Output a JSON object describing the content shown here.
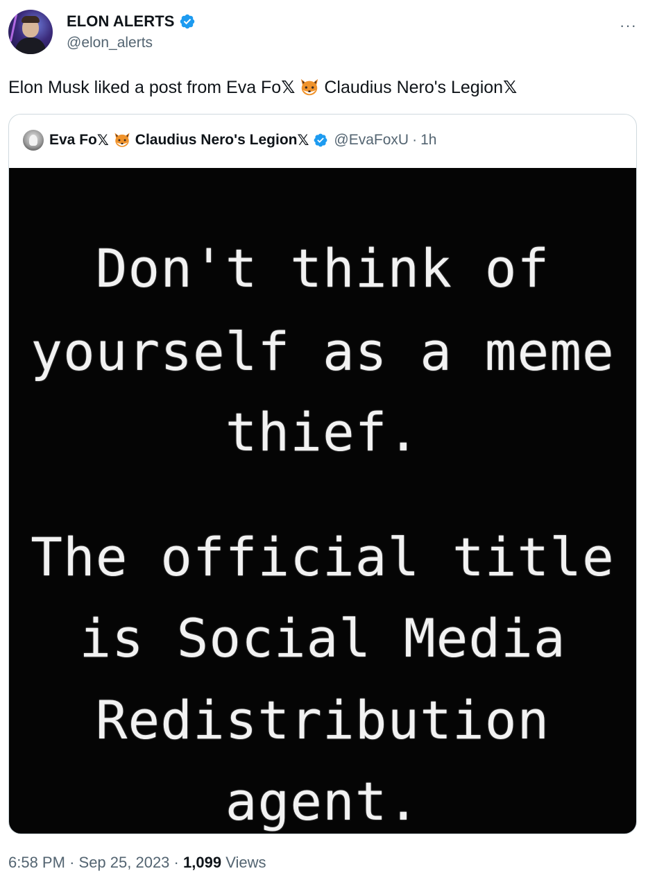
{
  "tweet": {
    "author": {
      "display_name": "ELON ALERTS",
      "handle": "@elon_alerts",
      "verified": true
    },
    "more_label": "···",
    "text_parts": [
      "Elon Musk liked a post from Eva Fo",
      "𝕏",
      "Claudius Nero's Legion ",
      "𝕏"
    ],
    "quote": {
      "display_name_a": "Eva Fo",
      "x_mark": "𝕏",
      "display_name_b": "Claudius Nero's Legion ",
      "x_mark_2": "𝕏",
      "handle": "@EvaFoxU",
      "separator": "·",
      "time": "1h",
      "image_lines": [
        "Don't think of",
        "yourself as a meme",
        "thief.",
        "The official title",
        "is Social Media",
        "Redistribution",
        "agent."
      ]
    },
    "footer": {
      "time": "6:58 PM",
      "sep1": "·",
      "date": "Sep 25, 2023",
      "sep2": "·",
      "views_count": "1,099",
      "views_label": "Views"
    },
    "colors": {
      "verified": "#1d9bf0",
      "secondary_text": "#536471",
      "border": "#cfd9de"
    },
    "icons": [
      "verified-badge-icon",
      "fox-emoji-icon",
      "more-options-icon"
    ]
  }
}
